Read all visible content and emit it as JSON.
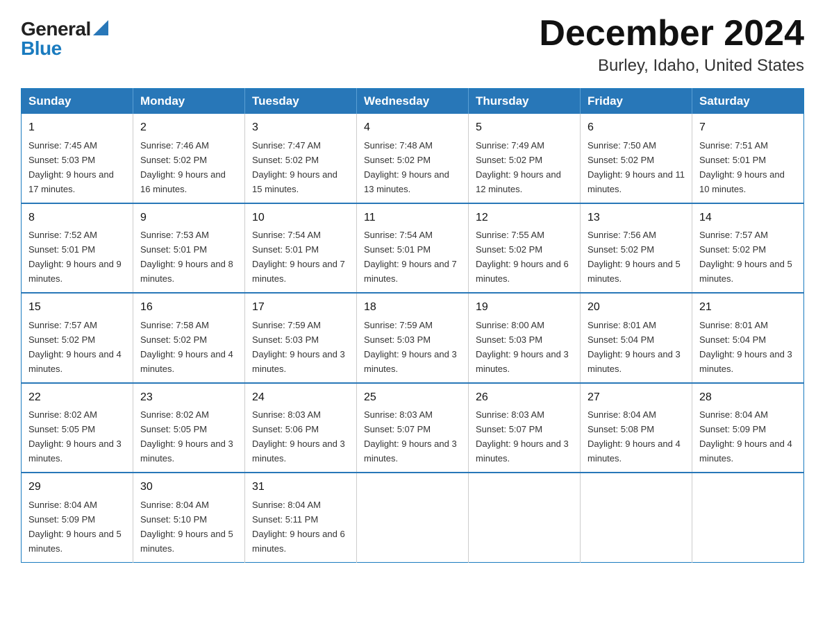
{
  "logo": {
    "general": "General",
    "blue": "Blue"
  },
  "title": {
    "month_year": "December 2024",
    "location": "Burley, Idaho, United States"
  },
  "weekdays": [
    "Sunday",
    "Monday",
    "Tuesday",
    "Wednesday",
    "Thursday",
    "Friday",
    "Saturday"
  ],
  "weeks": [
    [
      {
        "day": "1",
        "sunrise": "7:45 AM",
        "sunset": "5:03 PM",
        "daylight": "9 hours and 17 minutes."
      },
      {
        "day": "2",
        "sunrise": "7:46 AM",
        "sunset": "5:02 PM",
        "daylight": "9 hours and 16 minutes."
      },
      {
        "day": "3",
        "sunrise": "7:47 AM",
        "sunset": "5:02 PM",
        "daylight": "9 hours and 15 minutes."
      },
      {
        "day": "4",
        "sunrise": "7:48 AM",
        "sunset": "5:02 PM",
        "daylight": "9 hours and 13 minutes."
      },
      {
        "day": "5",
        "sunrise": "7:49 AM",
        "sunset": "5:02 PM",
        "daylight": "9 hours and 12 minutes."
      },
      {
        "day": "6",
        "sunrise": "7:50 AM",
        "sunset": "5:02 PM",
        "daylight": "9 hours and 11 minutes."
      },
      {
        "day": "7",
        "sunrise": "7:51 AM",
        "sunset": "5:01 PM",
        "daylight": "9 hours and 10 minutes."
      }
    ],
    [
      {
        "day": "8",
        "sunrise": "7:52 AM",
        "sunset": "5:01 PM",
        "daylight": "9 hours and 9 minutes."
      },
      {
        "day": "9",
        "sunrise": "7:53 AM",
        "sunset": "5:01 PM",
        "daylight": "9 hours and 8 minutes."
      },
      {
        "day": "10",
        "sunrise": "7:54 AM",
        "sunset": "5:01 PM",
        "daylight": "9 hours and 7 minutes."
      },
      {
        "day": "11",
        "sunrise": "7:54 AM",
        "sunset": "5:01 PM",
        "daylight": "9 hours and 7 minutes."
      },
      {
        "day": "12",
        "sunrise": "7:55 AM",
        "sunset": "5:02 PM",
        "daylight": "9 hours and 6 minutes."
      },
      {
        "day": "13",
        "sunrise": "7:56 AM",
        "sunset": "5:02 PM",
        "daylight": "9 hours and 5 minutes."
      },
      {
        "day": "14",
        "sunrise": "7:57 AM",
        "sunset": "5:02 PM",
        "daylight": "9 hours and 5 minutes."
      }
    ],
    [
      {
        "day": "15",
        "sunrise": "7:57 AM",
        "sunset": "5:02 PM",
        "daylight": "9 hours and 4 minutes."
      },
      {
        "day": "16",
        "sunrise": "7:58 AM",
        "sunset": "5:02 PM",
        "daylight": "9 hours and 4 minutes."
      },
      {
        "day": "17",
        "sunrise": "7:59 AM",
        "sunset": "5:03 PM",
        "daylight": "9 hours and 3 minutes."
      },
      {
        "day": "18",
        "sunrise": "7:59 AM",
        "sunset": "5:03 PM",
        "daylight": "9 hours and 3 minutes."
      },
      {
        "day": "19",
        "sunrise": "8:00 AM",
        "sunset": "5:03 PM",
        "daylight": "9 hours and 3 minutes."
      },
      {
        "day": "20",
        "sunrise": "8:01 AM",
        "sunset": "5:04 PM",
        "daylight": "9 hours and 3 minutes."
      },
      {
        "day": "21",
        "sunrise": "8:01 AM",
        "sunset": "5:04 PM",
        "daylight": "9 hours and 3 minutes."
      }
    ],
    [
      {
        "day": "22",
        "sunrise": "8:02 AM",
        "sunset": "5:05 PM",
        "daylight": "9 hours and 3 minutes."
      },
      {
        "day": "23",
        "sunrise": "8:02 AM",
        "sunset": "5:05 PM",
        "daylight": "9 hours and 3 minutes."
      },
      {
        "day": "24",
        "sunrise": "8:03 AM",
        "sunset": "5:06 PM",
        "daylight": "9 hours and 3 minutes."
      },
      {
        "day": "25",
        "sunrise": "8:03 AM",
        "sunset": "5:07 PM",
        "daylight": "9 hours and 3 minutes."
      },
      {
        "day": "26",
        "sunrise": "8:03 AM",
        "sunset": "5:07 PM",
        "daylight": "9 hours and 3 minutes."
      },
      {
        "day": "27",
        "sunrise": "8:04 AM",
        "sunset": "5:08 PM",
        "daylight": "9 hours and 4 minutes."
      },
      {
        "day": "28",
        "sunrise": "8:04 AM",
        "sunset": "5:09 PM",
        "daylight": "9 hours and 4 minutes."
      }
    ],
    [
      {
        "day": "29",
        "sunrise": "8:04 AM",
        "sunset": "5:09 PM",
        "daylight": "9 hours and 5 minutes."
      },
      {
        "day": "30",
        "sunrise": "8:04 AM",
        "sunset": "5:10 PM",
        "daylight": "9 hours and 5 minutes."
      },
      {
        "day": "31",
        "sunrise": "8:04 AM",
        "sunset": "5:11 PM",
        "daylight": "9 hours and 6 minutes."
      },
      null,
      null,
      null,
      null
    ]
  ]
}
